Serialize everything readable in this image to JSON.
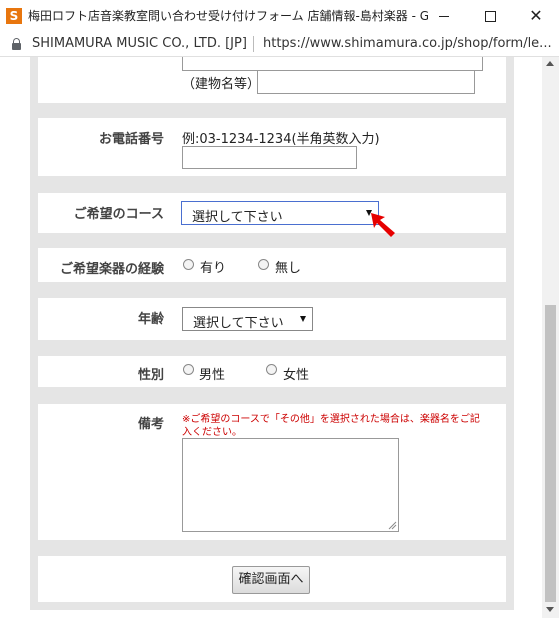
{
  "window": {
    "title": "梅田ロフト店音楽教室問い合わせ受け付けフォーム 店舗情報-島村楽器 - Googl...",
    "favicon_letter": "S"
  },
  "address_bar": {
    "site_name": "SHIMAMURA MUSIC CO., LTD. [JP]",
    "url": "https://www.shimamura.co.jp/shop/form/le..."
  },
  "form": {
    "building": {
      "label": "（建物名等）"
    },
    "phone": {
      "label": "お電話番号",
      "example": "例:03-1234-1234(半角英数入力)"
    },
    "course": {
      "label": "ご希望のコース",
      "selected": "選択して下さい"
    },
    "experience": {
      "label": "ご希望楽器の経験",
      "option_yes": "有り",
      "option_no": "無し"
    },
    "age": {
      "label": "年齢",
      "selected": "選択して下さい"
    },
    "gender": {
      "label": "性別",
      "option_male": "男性",
      "option_female": "女性"
    },
    "remarks": {
      "label": "備考",
      "note_line1": "※ご希望のコースで「その他」を選択された場合は、楽器名をご記",
      "note_line2": "入ください。"
    },
    "submit_label": "確認画面へ"
  },
  "colors": {
    "note": "#cc0000",
    "pointer": "#e60000",
    "favicon": "#e8760e"
  }
}
